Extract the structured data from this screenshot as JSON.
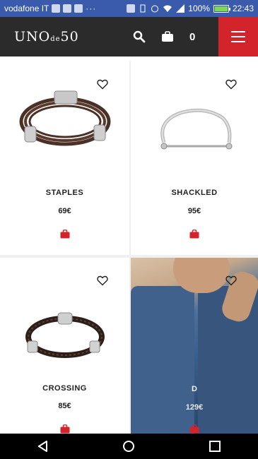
{
  "status_bar": {
    "carrier": "vodafone IT",
    "battery_text": "100%",
    "battery_level": 1.0,
    "time": "22:43",
    "dots": "···"
  },
  "header": {
    "logo_text": "UNO",
    "logo_de": "de",
    "logo_num": "50",
    "cart_count": "0",
    "accent_color": "#d3242c"
  },
  "products": [
    {
      "name": "STAPLES",
      "price": "69€"
    },
    {
      "name": "SHACKLED",
      "price": "95€"
    },
    {
      "name": "CROSSING",
      "price": "85€"
    },
    {
      "name": "D",
      "price": "129€"
    }
  ]
}
